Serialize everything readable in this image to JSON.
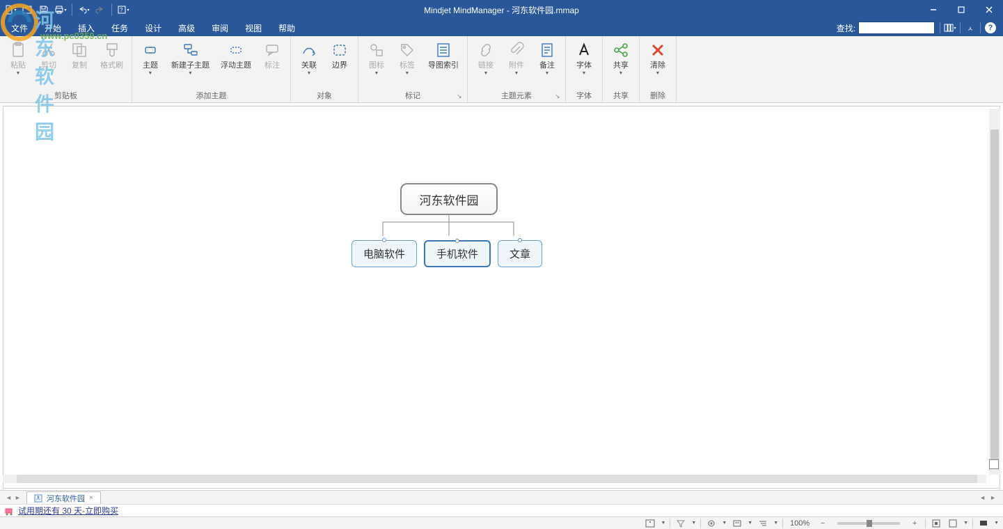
{
  "window": {
    "title": "Mindjet MindManager - 河东软件园.mmap"
  },
  "menu": {
    "items": [
      "文件",
      "开始",
      "插入",
      "任务",
      "设计",
      "高级",
      "审阅",
      "视图",
      "帮助"
    ],
    "search_label": "查找:",
    "search_value": ""
  },
  "ribbon": {
    "groups": [
      {
        "name": "剪贴板",
        "buttons": [
          {
            "label": "粘贴",
            "icon": "paste",
            "disabled": true,
            "dd": true
          },
          {
            "label": "剪切",
            "icon": "cut",
            "disabled": true
          },
          {
            "label": "复制",
            "icon": "copy",
            "disabled": true
          },
          {
            "label": "格式刷",
            "icon": "format-painter",
            "disabled": true
          }
        ]
      },
      {
        "name": "添加主题",
        "buttons": [
          {
            "label": "主题",
            "icon": "topic",
            "dd": true
          },
          {
            "label": "新建子主题",
            "icon": "subtopic",
            "dd": true
          },
          {
            "label": "浮动主题",
            "icon": "floating-topic"
          },
          {
            "label": "标注",
            "icon": "callout",
            "disabled": true
          }
        ]
      },
      {
        "name": "对象",
        "buttons": [
          {
            "label": "关联",
            "icon": "relationship",
            "dd": true
          },
          {
            "label": "边界",
            "icon": "boundary"
          }
        ]
      },
      {
        "name": "标记",
        "buttons": [
          {
            "label": "图标",
            "icon": "icons",
            "disabled": true,
            "dd": true
          },
          {
            "label": "标签",
            "icon": "tags",
            "disabled": true,
            "dd": true
          },
          {
            "label": "导图索引",
            "icon": "map-index"
          }
        ],
        "launcher": true
      },
      {
        "name": "主题元素",
        "buttons": [
          {
            "label": "链接",
            "icon": "hyperlink",
            "disabled": true,
            "dd": true
          },
          {
            "label": "附件",
            "icon": "attachment",
            "disabled": true,
            "dd": true
          },
          {
            "label": "备注",
            "icon": "notes",
            "dd": true
          }
        ],
        "launcher": true
      },
      {
        "name": "字体",
        "buttons": [
          {
            "label": "字体",
            "icon": "font",
            "dd": true
          }
        ]
      },
      {
        "name": "共享",
        "buttons": [
          {
            "label": "共享",
            "icon": "share",
            "dd": true
          }
        ]
      },
      {
        "name": "删除",
        "buttons": [
          {
            "label": "清除",
            "icon": "clear",
            "dd": true
          }
        ]
      }
    ]
  },
  "mindmap": {
    "central": "河东软件园",
    "children": [
      "电脑软件",
      "手机软件",
      "文章"
    ],
    "selected_index": 1
  },
  "tabs": {
    "doc_name": "河东软件园",
    "close": "×"
  },
  "trial": {
    "text": "试用期还有 30 天-立即购买"
  },
  "status": {
    "zoom": "100%"
  },
  "watermark": {
    "name": "河东软件园",
    "url": "www.pc0359.cn"
  }
}
